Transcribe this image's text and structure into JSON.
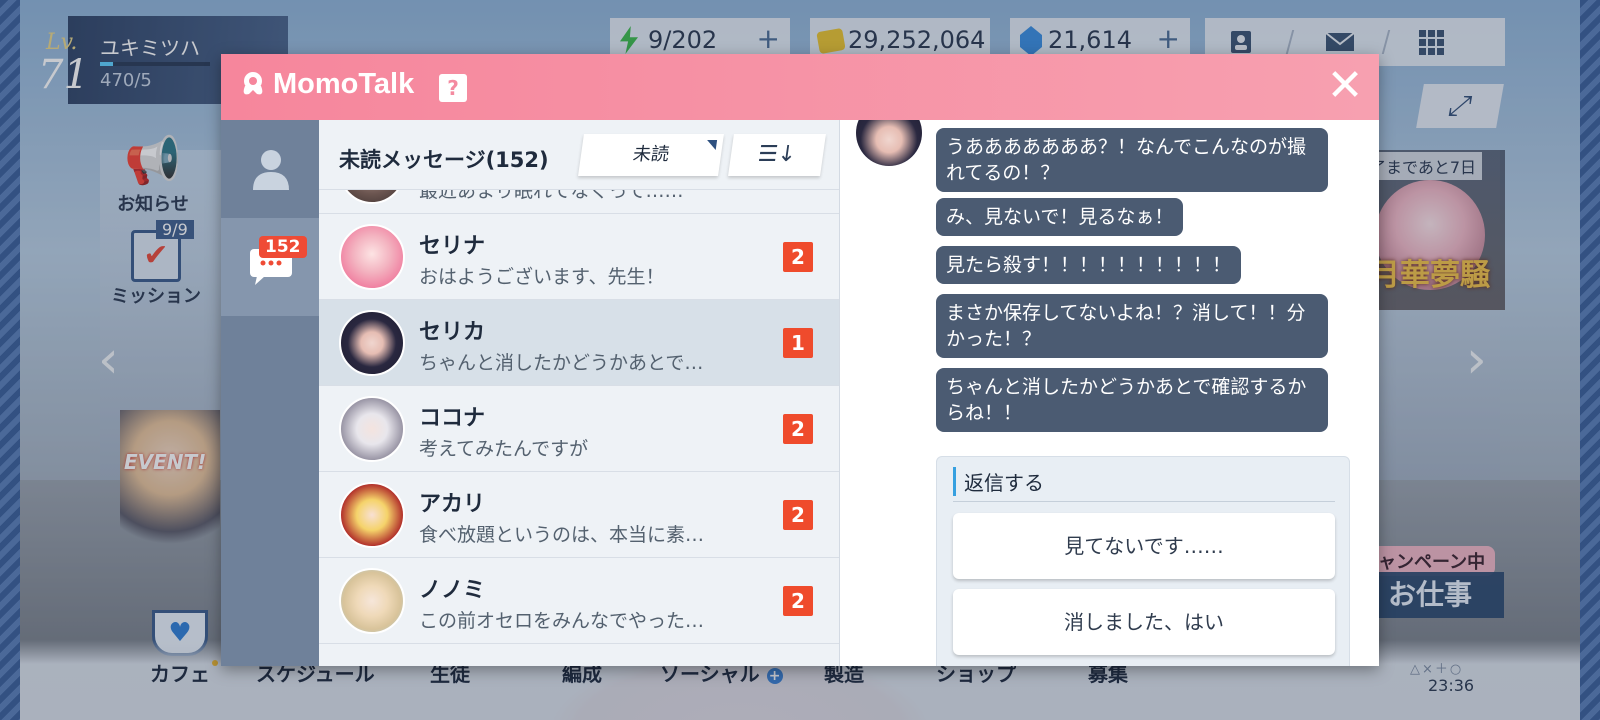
{
  "player": {
    "lv_label": "Lv.",
    "level": "71",
    "name": "ユキミツハ",
    "exp": "470/5"
  },
  "resources": {
    "ap": "9/202",
    "credit": "29,252,064",
    "gem": "21,614",
    "plus": "+"
  },
  "side": {
    "notice": "お知らせ",
    "mission": "ミッション",
    "mission_count": "9/9",
    "event_label": "EVENT!",
    "banner_time": "了まであと7日",
    "banner_title": "月華夢騒",
    "campaign": "キャンペーン中",
    "work": "お仕事"
  },
  "bottom_nav": [
    "カフェ",
    "スケジュール",
    "生徒",
    "編成",
    "ソーシャル",
    "製造",
    "ショップ",
    "募集"
  ],
  "clock": "23:36",
  "ps_symbols": "△×＋○",
  "momotalk": {
    "title": "MomoTalk",
    "help": "?",
    "unread_count": "152",
    "list_title": "未読メッセージ(152)",
    "filter_label": "未読",
    "contacts": [
      {
        "name": "",
        "preview": "最近あまり眠れてなくって……",
        "unread": ""
      },
      {
        "name": "セリナ",
        "preview": "おはようございます、先生！",
        "unread": "2"
      },
      {
        "name": "セリカ",
        "preview": "ちゃんと消したかどうかあとで…",
        "unread": "1"
      },
      {
        "name": "ココナ",
        "preview": "考えてみたんですが",
        "unread": "2"
      },
      {
        "name": "アカリ",
        "preview": "食べ放題というのは、本当に素…",
        "unread": "2"
      },
      {
        "name": "ノノミ",
        "preview": "この前オセロをみんなでやった…",
        "unread": "2"
      }
    ],
    "messages": [
      "うあああああああ？！なんでこんなのが撮れてるの！？",
      "み、見ないで！見るなぁ！",
      "見たら殺す！！！！！！！！！！",
      "まさか保存してないよね！？消して！！分かった！？",
      "ちゃんと消したかどうかあとで確認するからね！！"
    ],
    "reply": {
      "title": "返信する",
      "options": [
        "見てないです……",
        "消しました、はい"
      ]
    }
  },
  "colors": {
    "header_pink": "#f6869c",
    "sidebar": "#6f819a",
    "bubble": "#4b5b72",
    "badge": "#ef4b2c"
  },
  "icons": [
    "ap-bolt-icon",
    "credit-icon",
    "gem-icon",
    "profile-icon",
    "mail-icon",
    "grid-menu-icon",
    "fullscreen-icon",
    "megaphone-icon",
    "clipboard-icon",
    "cafe-cup-icon",
    "momo-logo-icon",
    "close-icon",
    "person-icon",
    "chat-icon",
    "sort-icon"
  ]
}
